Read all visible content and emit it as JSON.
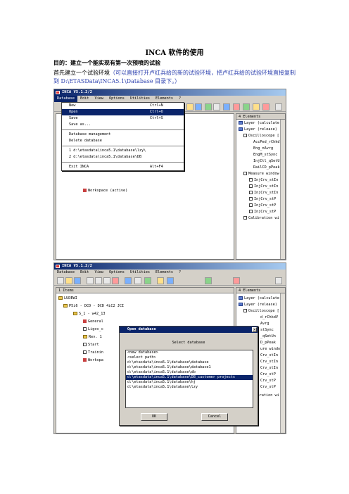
{
  "doc": {
    "title": "INCA 软件的使用",
    "purpose": "目的：建立一个能实现有第一次预喷的试验",
    "intro_a": "首先建立一个试验环境",
    "intro_b": "（可以直接打开卢红兵给的新的试验环境，把卢红兵给的试验环境直接复制到 D:\\ETASData\\INCA5.1\\Database 目录下。）"
  },
  "shot1": {
    "window_title": "INCA V5.1.2/2",
    "menus": [
      "Database",
      "Edit",
      "View",
      "Options",
      "Utilities",
      "Elements",
      "?"
    ],
    "dropdown": [
      {
        "label": "New",
        "shortcut": "Ctrl+N"
      },
      {
        "label": "Open",
        "shortcut": "Ctrl+O"
      },
      {
        "label": "Save",
        "shortcut": "Ctrl+S"
      },
      {
        "label": "Save as...",
        "shortcut": ""
      },
      {
        "label": "Database management",
        "shortcut": ""
      },
      {
        "label": "Delete database",
        "shortcut": ""
      },
      {
        "label": "1 d:\\etasdata\\inca5.1\\database\\lzy\\",
        "shortcut": ""
      },
      {
        "label": "2 d:\\etasdata\\inca5.1\\database\\DB",
        "shortcut": ""
      },
      {
        "label": "Exit INCA",
        "shortcut": "Alt+F4"
      }
    ],
    "workspace_label": "Workspace (active)",
    "elements_header": "4 Elements",
    "elements": [
      "Layer (calculate)",
      "Layer (release)",
      "Oscilloscope [",
      "AccPed_rChkdV",
      "Eng_nAvrg",
      "EngM_stSync",
      "InjCtl_qSetUnE",
      "RailCD_pPeak",
      "Measure window",
      "InjCrv_stIn",
      "InjCrv_stIn",
      "InjCrv_stIn",
      "InjCrv_stP",
      "InjCrv_stP",
      "InjCrv_stP",
      "Calibration wi"
    ]
  },
  "shot2": {
    "window_title": "INCA V5.1.2/2",
    "menus": [
      "Database",
      "Edit",
      "View",
      "Options",
      "Utilities",
      "Elements",
      "?"
    ],
    "items_header": "1 Items",
    "tree": [
      "LUDEWI",
      "P5i6 - DCD - DCD 4iC2 JCI",
      "S_1 - w42_13",
      "General",
      "Ligov_c",
      "Rev. 1",
      "Start",
      "Trainin",
      "Workspa"
    ],
    "elements_header": "4 Elements",
    "elements": [
      "Layer (calculate)",
      "Layer (release)",
      "Oscilloscope [",
      "d_rChkdV",
      "Avrg",
      "stSync",
      "_qSetUn",
      "D_pPeak",
      "ure windo",
      "Crv_stIn",
      "Crv_stIn",
      "Crv_stIn",
      "Crv_stP",
      "Crv_stP",
      "Crv_stP",
      "Calibration wi"
    ],
    "dialog": {
      "title": "Open database",
      "label": "Select database",
      "list": [
        "<new database>",
        "<select path>",
        "d:\\etasdata\\inca5.1\\database\\database",
        "d:\\etasdata\\inca5.1\\database\\database1",
        "d:\\etasdata\\inca5.1\\database\\db",
        "d:\\etasdata\\inca5.1\\database\\DB_customer projects",
        "d:\\etasdata\\inca5.1\\database\\hj",
        "d:\\etasdata\\inca5.1\\database\\lzy"
      ],
      "selected_index": 5,
      "ok": "OK",
      "cancel": "Cancel"
    }
  }
}
